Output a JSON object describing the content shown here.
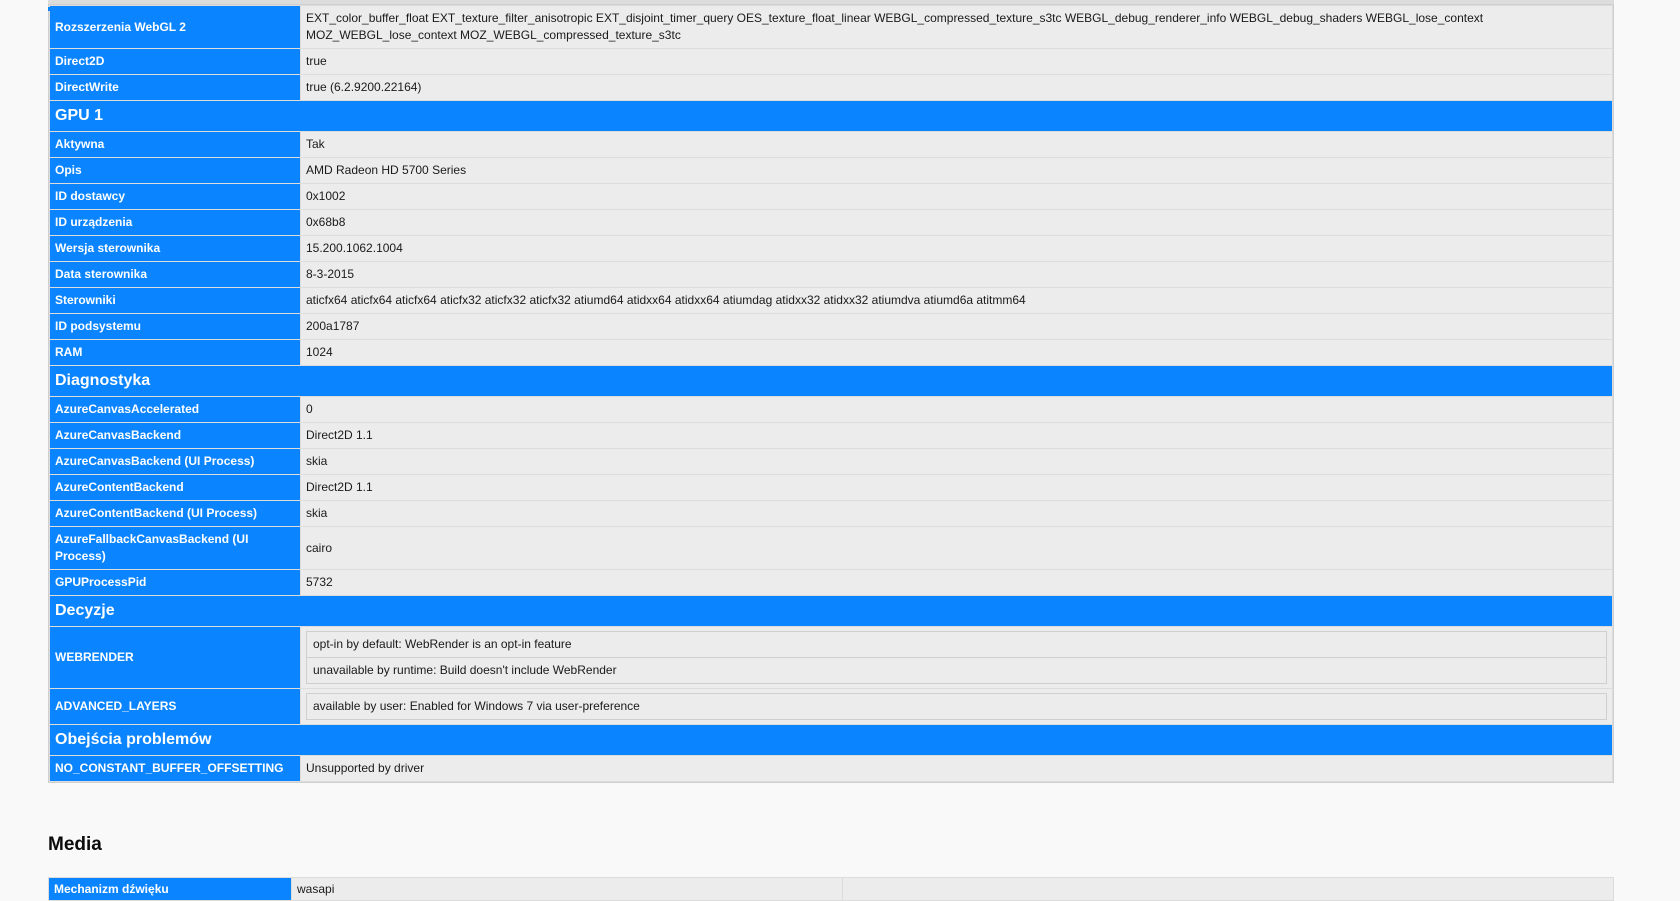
{
  "graphics": {
    "webgl2_ext": {
      "label": "Rozszerzenia WebGL 2",
      "value": "EXT_color_buffer_float EXT_texture_filter_anisotropic EXT_disjoint_timer_query OES_texture_float_linear WEBGL_compressed_texture_s3tc WEBGL_debug_renderer_info WEBGL_debug_shaders WEBGL_lose_context MOZ_WEBGL_lose_context MOZ_WEBGL_compressed_texture_s3tc"
    },
    "direct2d": {
      "label": "Direct2D",
      "value": "true"
    },
    "directwrite": {
      "label": "DirectWrite",
      "value": "true (6.2.9200.22164)"
    }
  },
  "gpu1": {
    "title": "GPU 1",
    "rows": [
      {
        "label": "Aktywna",
        "value": "Tak"
      },
      {
        "label": "Opis",
        "value": "AMD Radeon HD 5700 Series"
      },
      {
        "label": "ID dostawcy",
        "value": "0x1002"
      },
      {
        "label": "ID urządzenia",
        "value": "0x68b8"
      },
      {
        "label": "Wersja sterownika",
        "value": "15.200.1062.1004"
      },
      {
        "label": "Data sterownika",
        "value": "8-3-2015"
      },
      {
        "label": "Sterowniki",
        "value": "aticfx64 aticfx64 aticfx64 aticfx32 aticfx32 aticfx32 atiumd64 atidxx64 atidxx64 atiumdag atidxx32 atidxx32 atiumdva atiumd6a atitmm64"
      },
      {
        "label": "ID podsystemu",
        "value": "200a1787"
      },
      {
        "label": "RAM",
        "value": "1024"
      }
    ]
  },
  "diagnostics": {
    "title": "Diagnostyka",
    "rows": [
      {
        "label": "AzureCanvasAccelerated",
        "value": "0"
      },
      {
        "label": "AzureCanvasBackend",
        "value": "Direct2D 1.1"
      },
      {
        "label": "AzureCanvasBackend (UI Process)",
        "value": "skia"
      },
      {
        "label": "AzureContentBackend",
        "value": "Direct2D 1.1"
      },
      {
        "label": "AzureContentBackend (UI Process)",
        "value": "skia"
      },
      {
        "label": "AzureFallbackCanvasBackend (UI Process)",
        "value": "cairo"
      },
      {
        "label": "GPUProcessPid",
        "value": "5732"
      }
    ]
  },
  "decisions": {
    "title": "Decyzje",
    "webrender": {
      "label": "WEBRENDER",
      "items": [
        "opt-in by default: WebRender is an opt-in feature",
        "unavailable by runtime: Build doesn't include WebRender"
      ]
    },
    "advanced_layers": {
      "label": "ADVANCED_LAYERS",
      "items": [
        "available by user: Enabled for Windows 7 via user-preference"
      ]
    }
  },
  "workarounds": {
    "title": "Obejścia problemów",
    "rows": [
      {
        "label": "NO_CONSTANT_BUFFER_OFFSETTING",
        "value": "Unsupported by driver"
      }
    ]
  },
  "media": {
    "title": "Media",
    "rows": [
      {
        "label": "Mechanizm dźwięku",
        "value": "wasapi"
      }
    ]
  }
}
